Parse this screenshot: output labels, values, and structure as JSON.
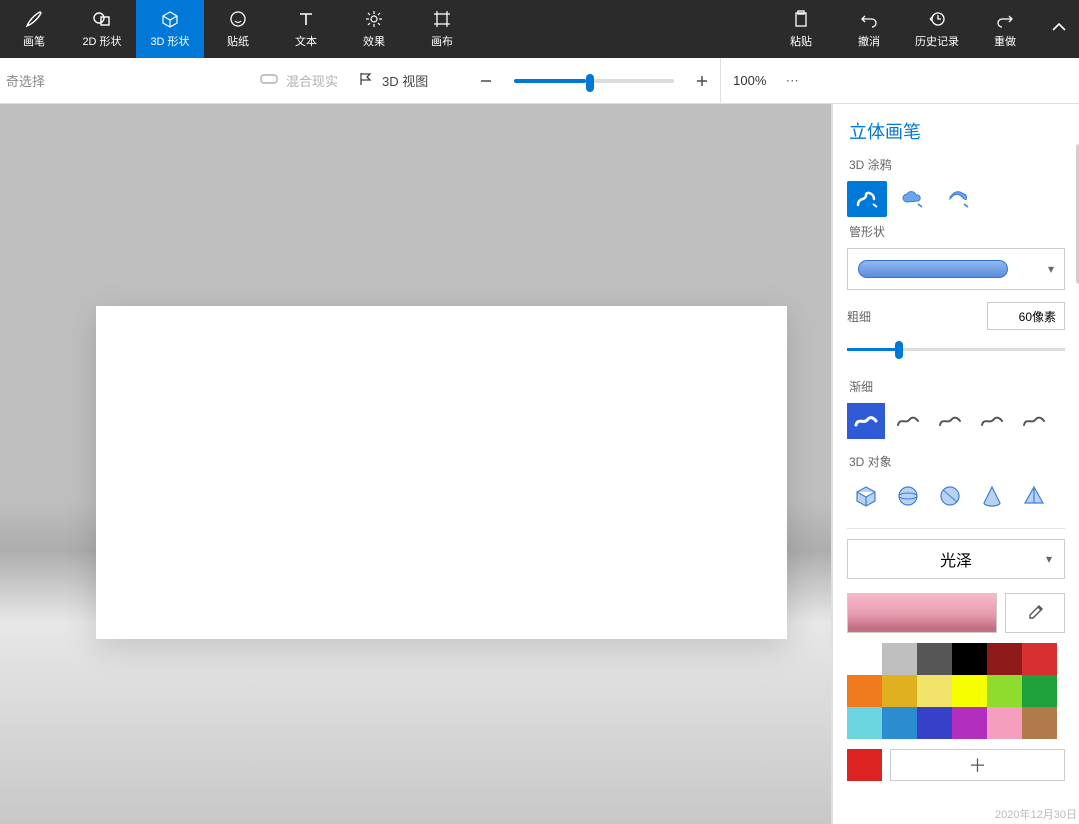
{
  "toolbar": {
    "tabs": [
      {
        "label": "画笔"
      },
      {
        "label": "2D 形状"
      },
      {
        "label": "3D 形状"
      },
      {
        "label": "贴纸"
      },
      {
        "label": "文本"
      },
      {
        "label": "效果"
      },
      {
        "label": "画布"
      }
    ],
    "right": [
      {
        "label": "粘贴"
      },
      {
        "label": "撤消"
      },
      {
        "label": "历史记录"
      },
      {
        "label": "重做"
      }
    ]
  },
  "secbar": {
    "select_label": "奇选择",
    "mixed_label": "混合现实",
    "view3d_label": "3D 视图",
    "zoom_value": "100%"
  },
  "panel": {
    "title": "立体画笔",
    "graffiti_label": "3D 涂鸦",
    "tube_label": "管形状",
    "thickness_label": "粗细",
    "thickness_value": "60像素",
    "taper_label": "渐细",
    "obj3d_label": "3D 对象",
    "gloss_label": "光泽",
    "date": "2020年12月30日"
  },
  "palette": [
    "#ffffff",
    "#bfbfbf",
    "#565656",
    "#000000",
    "#8e1a1a",
    "#d83030",
    "#f07a1e",
    "#e0b020",
    "#f2e36b",
    "#f6ff00",
    "#8fdb2e",
    "#1ea03b",
    "#6bd6e0",
    "#2b8ccf",
    "#3640c9",
    "#b22fbd",
    "#f59ebd",
    "#b07a4b"
  ]
}
